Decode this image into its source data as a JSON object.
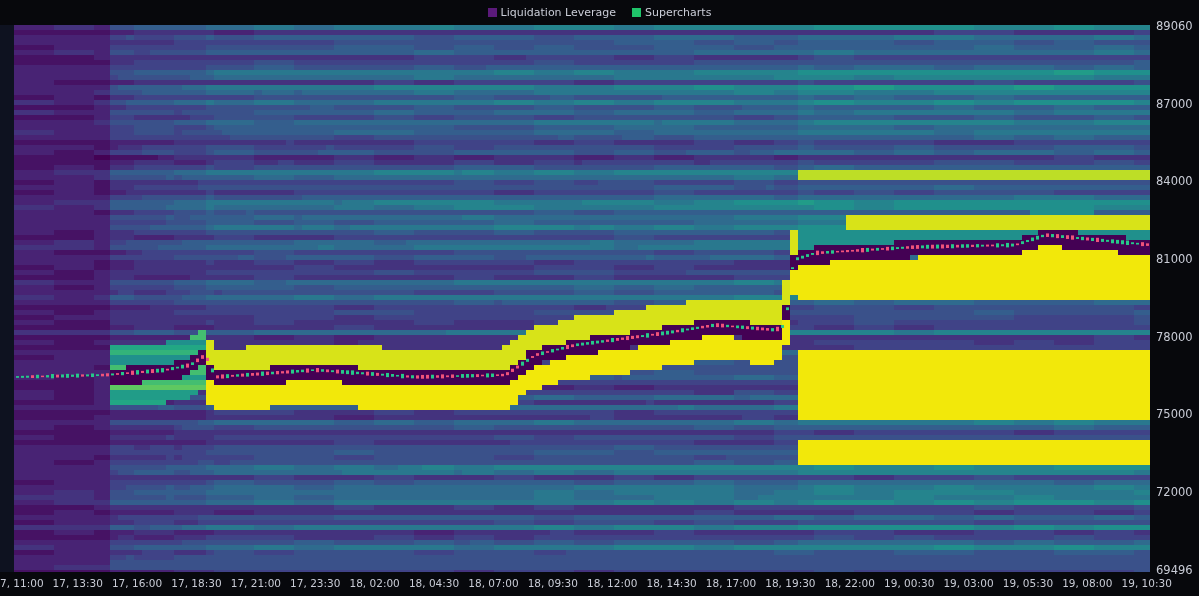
{
  "legend": [
    {
      "label": "Liquidation Leverage",
      "color": "#5b1a7a"
    },
    {
      "label": "Supercharts",
      "color": "#1fc46a"
    }
  ],
  "y_axis": {
    "labels": [
      "89060",
      "87000",
      "84000",
      "81000",
      "78000",
      "75000",
      "72000",
      "69496"
    ]
  },
  "x_axis": {
    "labels": [
      "7, 11:00",
      "17, 13:30",
      "17, 16:00",
      "17, 18:30",
      "17, 21:00",
      "17, 23:30",
      "18, 02:00",
      "18, 04:30",
      "18, 07:00",
      "18, 09:30",
      "18, 12:00",
      "18, 14:30",
      "18, 17:00",
      "18, 19:30",
      "18, 22:00",
      "19, 00:30",
      "19, 03:00",
      "19, 05:30",
      "19, 08:00",
      "19, 10:30"
    ]
  }
}
